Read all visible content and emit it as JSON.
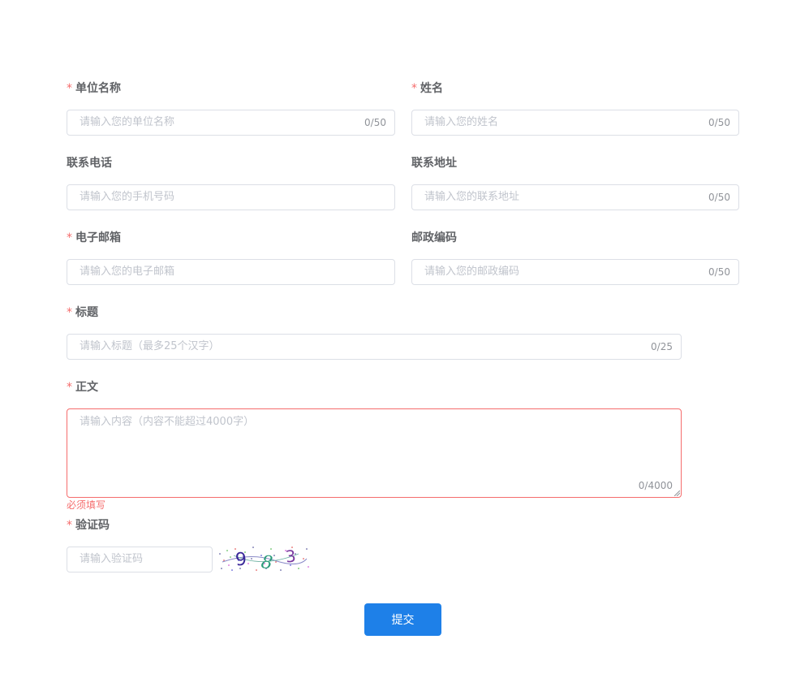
{
  "form": {
    "required_mark": "*",
    "unit": {
      "label": "单位名称",
      "placeholder": "请输入您的单位名称",
      "count": "0/50"
    },
    "name": {
      "label": "姓名",
      "placeholder": "请输入您的姓名",
      "count": "0/50"
    },
    "phone": {
      "label": "联系电话",
      "placeholder": "请输入您的手机号码"
    },
    "address": {
      "label": "联系地址",
      "placeholder": "请输入您的联系地址",
      "count": "0/50"
    },
    "email": {
      "label": "电子邮箱",
      "placeholder": "请输入您的电子邮箱"
    },
    "postcode": {
      "label": "邮政编码",
      "placeholder": "请输入您的邮政编码",
      "count": "0/50"
    },
    "title": {
      "label": "标题",
      "placeholder": "请输入标题（最多25个汉字）",
      "count": "0/25"
    },
    "body": {
      "label": "正文",
      "placeholder": "请输入内容（内容不能超过4000字）",
      "count": "0/4000",
      "error": "必须填写"
    },
    "captcha": {
      "label": "验证码",
      "placeholder": "请输入验证码",
      "image_text": "9 8 3"
    },
    "submit_label": "提交"
  },
  "colors": {
    "required": "#f56c6c",
    "primary_button": "#1e80e8",
    "error_border": "#f56c6c"
  }
}
